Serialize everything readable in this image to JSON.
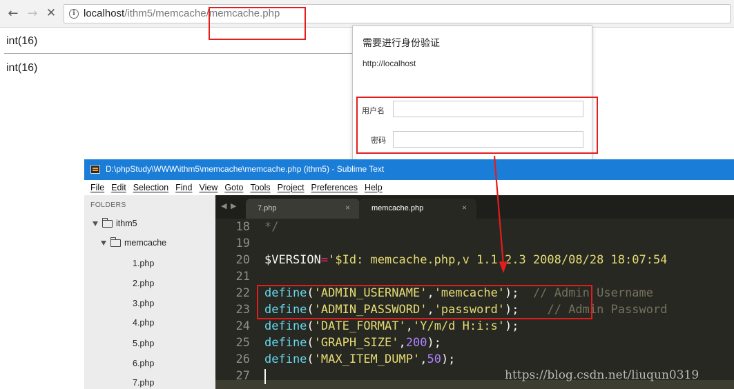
{
  "browser": {
    "nav": {
      "back": "←",
      "forward": "→",
      "stop": "✕"
    },
    "address": {
      "host": "localhost",
      "path": "/ithm5/memcache/memcache.php",
      "icon": "info-icon"
    }
  },
  "page": {
    "lines": [
      "int(16)",
      "int(16)"
    ]
  },
  "auth_dialog": {
    "title": "需要进行身份验证",
    "host": "http://localhost",
    "username_label": "用户名",
    "password_label": "密码",
    "username_value": "",
    "password_value": ""
  },
  "sublime": {
    "title": "D:\\phpStudy\\WWW\\ithm5\\memcache\\memcache.php (ithm5) - Sublime Text",
    "menu": [
      "File",
      "Edit",
      "Selection",
      "Find",
      "View",
      "Goto",
      "Tools",
      "Project",
      "Preferences",
      "Help"
    ],
    "sidebar": {
      "heading": "FOLDERS",
      "root": "ithm5",
      "folder": "memcache",
      "files": [
        "1.php",
        "2.php",
        "3.php",
        "4.php",
        "5.php",
        "6.php",
        "7.php"
      ]
    },
    "tabs": [
      {
        "label": "7.php",
        "active": false,
        "close": "×"
      },
      {
        "label": "memcache.php",
        "active": true,
        "close": "×"
      }
    ],
    "tab_nav": {
      "left": "◀",
      "right": "▶"
    },
    "line_numbers": [
      "18",
      "19",
      "20",
      "21",
      "22",
      "23",
      "24",
      "25",
      "26",
      "27"
    ],
    "code": {
      "l18": "*/",
      "l20_var": "$VERSION",
      "l20_op": "=",
      "l20_str": "'$Id: memcache.php,v 1.1.2.3 2008/08/28 18:07:54",
      "l22_fn": "define",
      "l22_a": "'ADMIN_USERNAME'",
      "l22_b": "'memcache'",
      "l22_comment": "// Admin Username",
      "l23_fn": "define",
      "l23_a": "'ADMIN_PASSWORD'",
      "l23_b": "'password'",
      "l23_comment": "// Admin Password",
      "l24_fn": "define",
      "l24_a": "'DATE_FORMAT'",
      "l24_b": "'Y/m/d H:i:s'",
      "l25_fn": "define",
      "l25_a": "'GRAPH_SIZE'",
      "l25_n": "200",
      "l26_fn": "define",
      "l26_a": "'MAX_ITEM_DUMP'",
      "l26_n": "50",
      "open_paren": "(",
      "comma": ",",
      "close_stmt": ");"
    }
  },
  "watermark": "https://blog.csdn.net/liuqun0319",
  "colors": {
    "annotation_red": "#e51c1c",
    "sublime_titlebar": "#1a7dd8",
    "editor_bg": "#272822"
  }
}
